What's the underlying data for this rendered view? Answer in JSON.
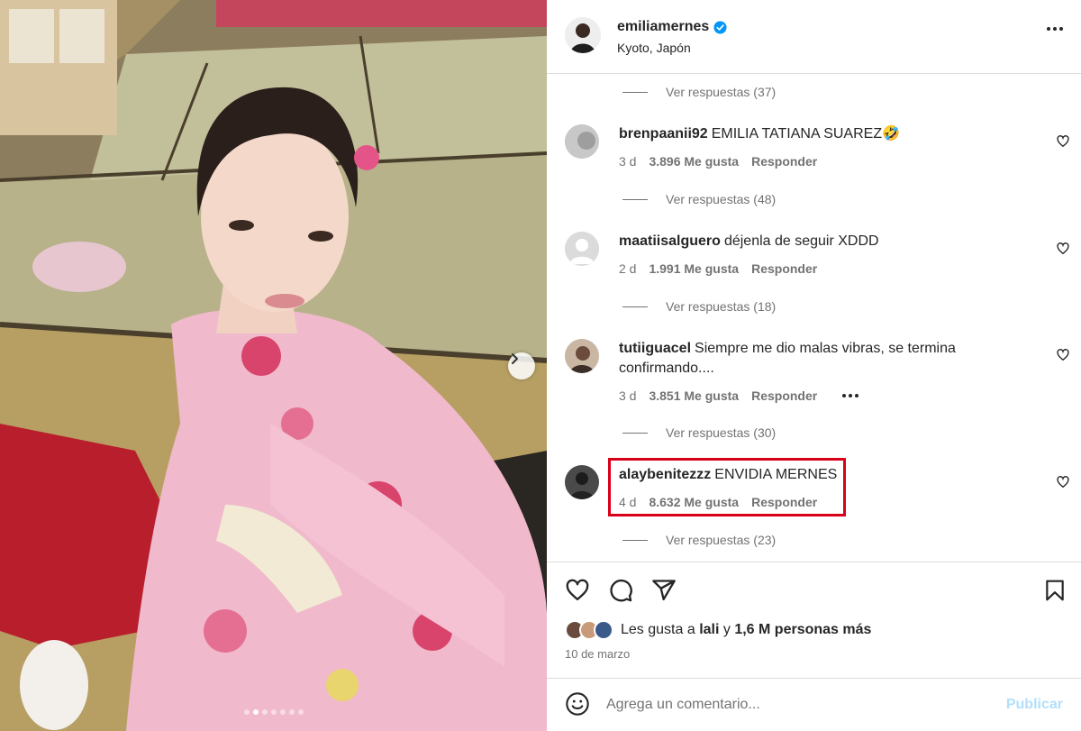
{
  "post": {
    "username": "emiliamernes",
    "location": "Kyoto, Japón",
    "verified": true
  },
  "comments": [
    {
      "user": "brenpaanii92",
      "text": "EMILIA TATIANA SUAREZ🤣",
      "age": "3 d",
      "likes": "3.896 Me gusta",
      "reply": "Responder",
      "replies": "Ver respuestas (48)"
    },
    {
      "user": "maatiisalguero",
      "text": "déjenla de seguir XDDD",
      "age": "2 d",
      "likes": "1.991 Me gusta",
      "reply": "Responder",
      "replies": "Ver respuestas (18)"
    },
    {
      "user": "tutiiguacel",
      "text": "Siempre me dio malas vibras, se termina confirmando....",
      "age": "3 d",
      "likes": "3.851 Me gusta",
      "reply": "Responder",
      "replies": "Ver respuestas (30)"
    },
    {
      "user": "alaybenitezzz",
      "text": "ENVIDIA MERNES",
      "age": "4 d",
      "likes": "8.632 Me gusta",
      "reply": "Responder",
      "replies": "Ver respuestas (23)"
    }
  ],
  "top_replies": "Ver respuestas (37)",
  "likes_summary": {
    "prefix": "Les gusta a",
    "first": "lali",
    "middle": "y",
    "rest": "1,6 M personas más"
  },
  "date": "10 de marzo",
  "comment_box": {
    "placeholder": "Agrega un comentario...",
    "publish": "Publicar"
  },
  "colors": {
    "highlight": "#d90019",
    "verified": "#0095f6",
    "publish_disabled": "#b2dffc"
  },
  "carousel": {
    "dot_count": 7,
    "active_dot": 1
  }
}
